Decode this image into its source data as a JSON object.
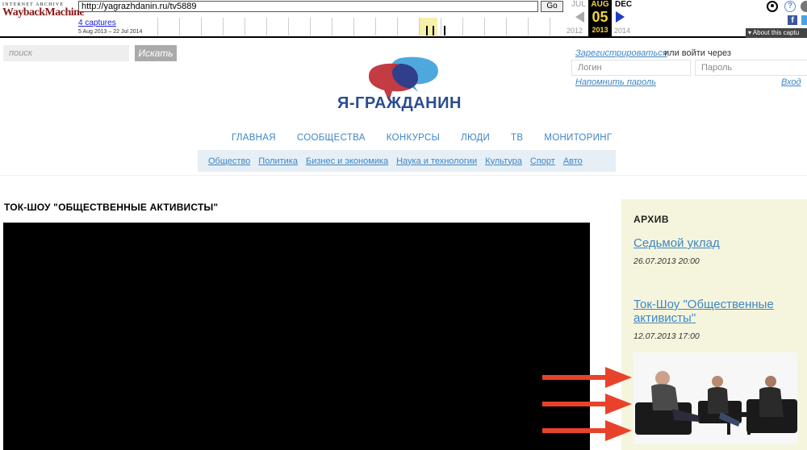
{
  "wayback": {
    "logo_top": "INTERNET ARCHIVE",
    "logo_main": "WaybackMachine",
    "url": "http://yagrazhdanin.ru/tv5889",
    "go_label": "Go",
    "captures": "4 captures",
    "range": "5 Aug 2013 – 22 Jul 2014",
    "prev_month": "JUL",
    "cur_month": "AUG",
    "cur_day": "05",
    "cur_year": "2013",
    "next_month": "DEC",
    "prev_year": "2012",
    "next_year": "2014",
    "help": "?",
    "facebook": "f",
    "about": "▾ About this captu"
  },
  "site": {
    "search_placeholder": "поиск",
    "search_button": "Искать",
    "logo_text": "Я-ГРАЖДАНИН",
    "register": "Зарегистрироваться",
    "or_login": "или войти через",
    "login_placeholder": "Логин",
    "password_placeholder": "Пароль",
    "remind": "Напомнить пароль",
    "enter": "Вход",
    "main_nav": [
      "ГЛАВНАЯ",
      "СООБЩЕСТВА",
      "КОНКУРСЫ",
      "ЛЮДИ",
      "ТВ",
      "МОНИТОРИНГ"
    ],
    "sub_nav": [
      "Общество",
      "Политика",
      "Бизнес и экономика",
      "Наука и технологии",
      "Культура",
      "Спорт",
      "Авто"
    ],
    "colors": {
      "link": "#3e86c5",
      "logo_red": "#c0313a",
      "logo_blue": "#4fa8dd",
      "archive_bg": "#f5f5dd",
      "arrow": "#e8432a"
    }
  },
  "content": {
    "page_title": "ТОК-ШОУ \"ОБЩЕСТВЕННЫЕ АКТИВИСТЫ\""
  },
  "archive": {
    "heading": "АРХИВ",
    "items": [
      {
        "title": "Седьмой уклад",
        "date": "26.07.2013 20:00"
      },
      {
        "title": "Ток-Шоу \"Общественные активисты\"",
        "date": "12.07.2013 17:00"
      }
    ]
  }
}
